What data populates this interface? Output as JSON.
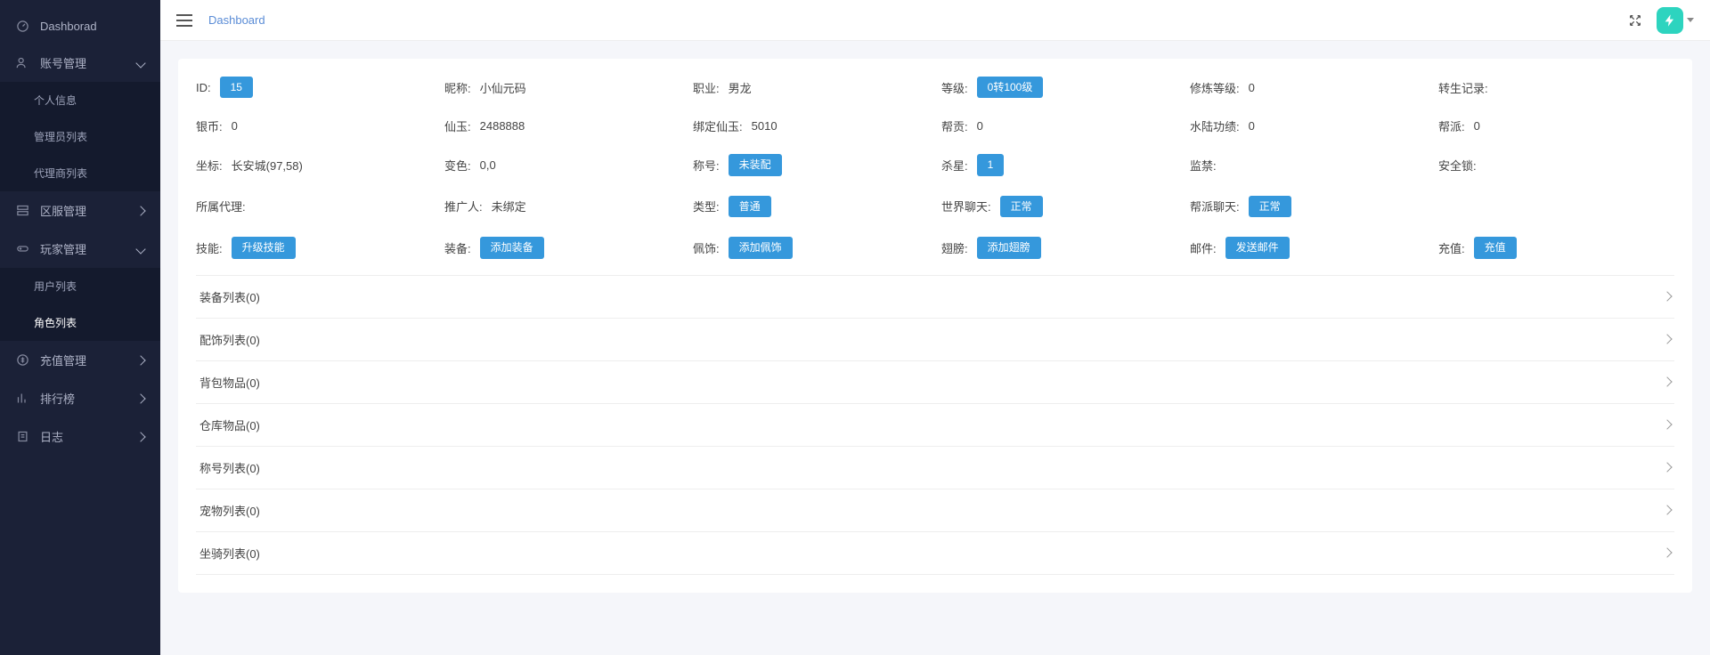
{
  "sidebar": {
    "items": [
      {
        "label": "Dashborad"
      },
      {
        "label": "账号管理",
        "children": [
          {
            "label": "个人信息"
          },
          {
            "label": "管理员列表"
          },
          {
            "label": "代理商列表"
          }
        ]
      },
      {
        "label": "区服管理"
      },
      {
        "label": "玩家管理",
        "children": [
          {
            "label": "用户列表"
          },
          {
            "label": "角色列表"
          }
        ]
      },
      {
        "label": "充值管理"
      },
      {
        "label": "排行榜"
      },
      {
        "label": "日志"
      }
    ]
  },
  "breadcrumb": "Dashboard",
  "info": {
    "id_label": "ID",
    "id_btn": "15",
    "nick_label": "昵称",
    "nick_val": "小仙元码",
    "job_label": "职业",
    "job_val": "男龙",
    "level_label": "等级",
    "level_btn": "0转100级",
    "train_label": "修炼等级",
    "train_val": "0",
    "rebirth_label": "转生记录",
    "silver_label": "银币",
    "silver_val": "0",
    "jade_label": "仙玉",
    "jade_val": "2488888",
    "bound_label": "绑定仙玉",
    "bound_val": "5010",
    "contrib_label": "帮贡",
    "contrib_val": "0",
    "merit_label": "水陆功绩",
    "merit_val": "0",
    "guild_label": "帮派",
    "guild_val": "0",
    "coord_label": "坐标",
    "coord_val": "长安城(97,58)",
    "color_label": "变色",
    "color_val": "0,0",
    "title_label": "称号",
    "title_btn": "未装配",
    "kill_label": "杀星",
    "kill_btn": "1",
    "ban_label": "监禁",
    "lock_label": "安全锁",
    "agent_label": "所属代理",
    "promoter_label": "推广人",
    "promoter_val": "未绑定",
    "type_label": "类型",
    "type_btn": "普通",
    "worldchat_label": "世界聊天",
    "worldchat_btn": "正常",
    "guildchat_label": "帮派聊天",
    "guildchat_btn": "正常",
    "skill_label": "技能",
    "skill_btn": "升级技能",
    "equip_label": "装备",
    "equip_btn": "添加装备",
    "pendant_label": "佩饰",
    "pendant_btn": "添加佩饰",
    "wing_label": "翅膀",
    "wing_btn": "添加翅膀",
    "mail_label": "邮件",
    "mail_btn": "发送邮件",
    "recharge_label": "充值",
    "recharge_btn": "充值"
  },
  "accordion": [
    "装备列表(0)",
    "配饰列表(0)",
    "背包物品(0)",
    "仓库物品(0)",
    "称号列表(0)",
    "宠物列表(0)",
    "坐骑列表(0)"
  ]
}
